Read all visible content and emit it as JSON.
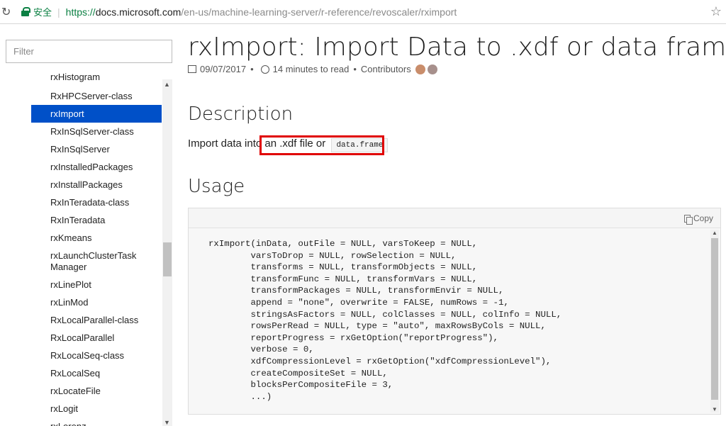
{
  "browser": {
    "secure_label": "安全",
    "url_scheme": "https://",
    "url_host": "docs.microsoft.com",
    "url_path": "/en-us/machine-learning-server/r-reference/revoscaler/rximport"
  },
  "sidebar": {
    "filter_placeholder": "Filter",
    "items": [
      {
        "label": "rxHistogram"
      },
      {
        "label": "RxHPCServer-class"
      },
      {
        "label": "rxImport",
        "active": true
      },
      {
        "label": "RxInSqlServer-class"
      },
      {
        "label": "RxInSqlServer"
      },
      {
        "label": "rxInstalledPackages"
      },
      {
        "label": "rxInstallPackages"
      },
      {
        "label": "RxInTeradata-class"
      },
      {
        "label": "RxInTeradata"
      },
      {
        "label": "rxKmeans"
      },
      {
        "label": "rxLaunchClusterTask"
      },
      {
        "label": "Manager"
      },
      {
        "label": "rxLinePlot"
      },
      {
        "label": "rxLinMod"
      },
      {
        "label": "RxLocalParallel-class"
      },
      {
        "label": "RxLocalParallel"
      },
      {
        "label": "RxLocalSeq-class"
      },
      {
        "label": "RxLocalSeq"
      },
      {
        "label": "rxLocateFile"
      },
      {
        "label": "rxLogit"
      },
      {
        "label": "rxLorenz"
      }
    ]
  },
  "article": {
    "title": "rxImport: Import Data to .xdf or data frame",
    "date": "09/07/2017",
    "read_time": "14 minutes to read",
    "contributors_label": "Contributors",
    "description_heading": "Description",
    "description_text": "Import data into an .xdf file or",
    "description_code": "data.frame",
    "usage_heading": "Usage",
    "copy_label": "Copy",
    "code": "rxImport(inData, outFile = NULL, varsToKeep = NULL,\n        varsToDrop = NULL, rowSelection = NULL,\n        transforms = NULL, transformObjects = NULL,\n        transformFunc = NULL, transformVars = NULL,\n        transformPackages = NULL, transformEnvir = NULL,\n        append = \"none\", overwrite = FALSE, numRows = -1,\n        stringsAsFactors = NULL, colClasses = NULL, colInfo = NULL,\n        rowsPerRead = NULL, type = \"auto\", maxRowsByCols = NULL,\n        reportProgress = rxGetOption(\"reportProgress\"),\n        verbose = 0,\n        xdfCompressionLevel = rxGetOption(\"xdfCompressionLevel\"),\n        createCompositeSet = NULL,\n        blocksPerCompositeFile = 3,\n        ...)"
  }
}
